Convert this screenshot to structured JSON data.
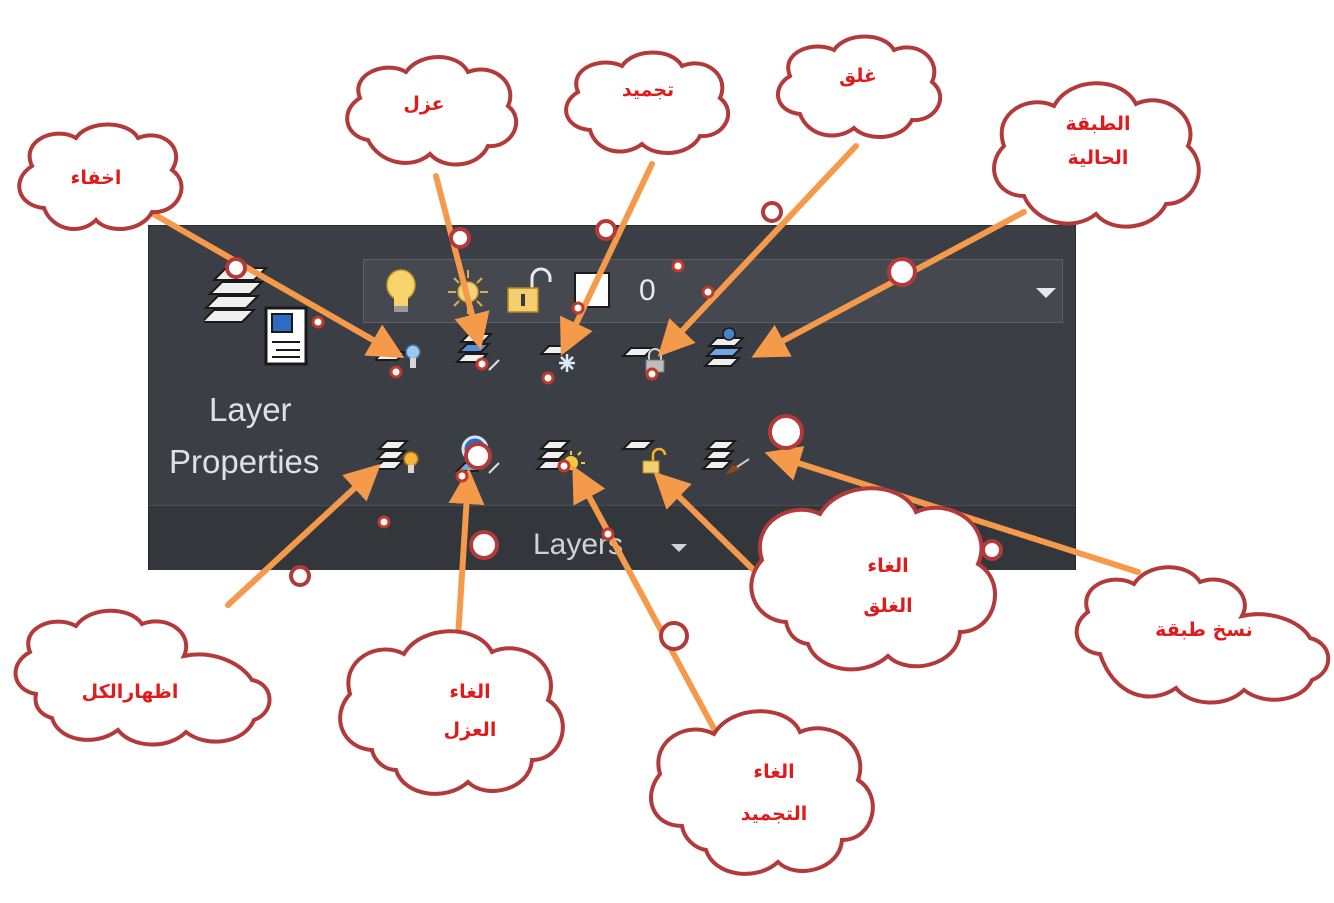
{
  "panel": {
    "title": "Layers",
    "layer_properties": {
      "line1": "Layer",
      "line2": "Properties"
    },
    "dropdown": {
      "layer_name": "0",
      "icons": [
        "lightbulb-on-icon",
        "sun-thaw-icon",
        "padlock-unlocked-icon",
        "color-swatch"
      ]
    }
  },
  "tools": [
    {
      "id": "off",
      "icon": "layer-off-icon"
    },
    {
      "id": "isolate",
      "icon": "layer-isolate-icon"
    },
    {
      "id": "freeze",
      "icon": "layer-freeze-icon"
    },
    {
      "id": "lock",
      "icon": "layer-lock-icon"
    },
    {
      "id": "make-current",
      "icon": "make-current-layer-icon"
    },
    {
      "id": "turn-all-on",
      "icon": "turn-all-layers-on-icon"
    },
    {
      "id": "unisolate",
      "icon": "layer-unisolate-icon"
    },
    {
      "id": "thaw-all",
      "icon": "thaw-all-layers-icon"
    },
    {
      "id": "unlock",
      "icon": "layer-unlock-icon"
    },
    {
      "id": "copy-layer",
      "icon": "copy-objects-to-layer-icon"
    }
  ],
  "callouts": {
    "hide": "اخفاء",
    "isolate": "عزل",
    "freeze": "تجميد",
    "lock": "غلق",
    "current_layer": [
      "الطبقة",
      "الحالية"
    ],
    "show_all": "اظهارالكل",
    "cancel_isolate": [
      "الغاء",
      "العزل"
    ],
    "cancel_freeze": [
      "الغاء",
      "التجميد"
    ],
    "cancel_lock": [
      "الغاء",
      "الغلق"
    ],
    "copy_layer": "نسخ طبقة"
  },
  "colors": {
    "panel_bg": "#3b3e44",
    "callout_stroke": "#b23a3a",
    "callout_text": "#e01b1b",
    "arrow": "#f59a4b",
    "dot": "#c0392b"
  }
}
